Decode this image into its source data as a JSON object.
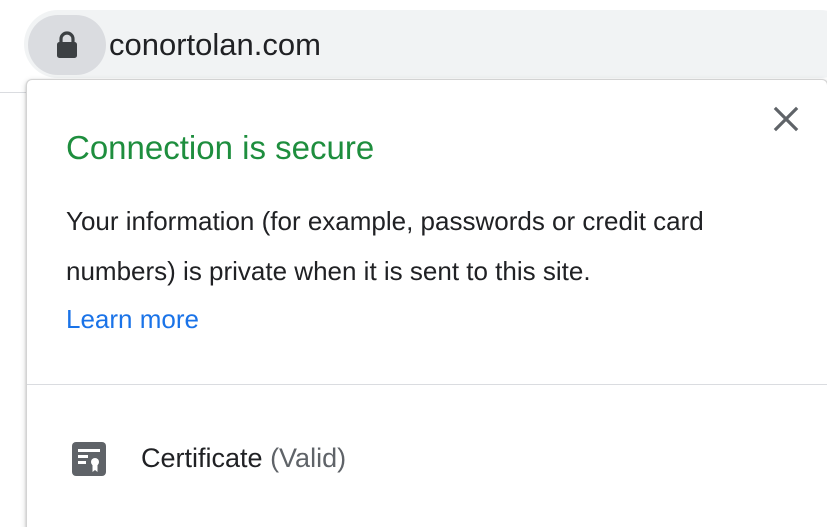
{
  "omnibox": {
    "url": "conortolan.com",
    "lock_icon": "lock-icon"
  },
  "popup": {
    "title": "Connection is secure",
    "description": "Your information (for example, passwords or credit card numbers) is private when it is sent to this site.",
    "learn_more": "Learn more",
    "close_icon": "close-icon",
    "certificate": {
      "label": "Certificate",
      "status": "(Valid)",
      "icon": "certificate-icon"
    }
  },
  "colors": {
    "secure_green": "#1e8e3e",
    "link_blue": "#1a73e8",
    "text": "#202124",
    "secondary_text": "#5f6368",
    "chip_bg": "#dadce0",
    "omnibox_bg": "#f1f3f4"
  }
}
